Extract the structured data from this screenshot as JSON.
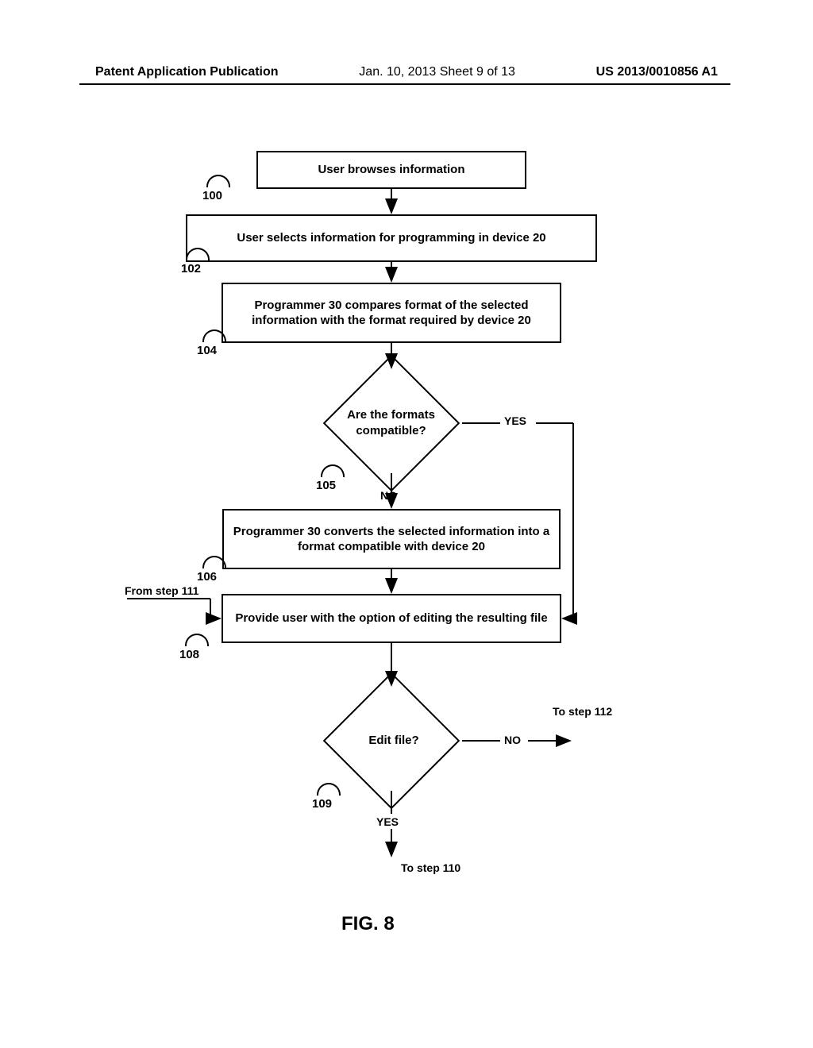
{
  "header": {
    "left": "Patent Application Publication",
    "center": "Jan. 10, 2013  Sheet 9 of 13",
    "right": "US 2013/0010856 A1"
  },
  "boxes": {
    "b100": "User browses information",
    "b102": "User selects information for programming in device 20",
    "b104": "Programmer 30 compares format of the selected information with the format required by device 20",
    "b106": "Programmer 30 converts the selected information into a format compatible with device 20",
    "b108": "Provide user with the option of editing the resulting file"
  },
  "diamonds": {
    "d105": "Are the formats compatible?",
    "d109": "Edit file?"
  },
  "refs": {
    "r100": "100",
    "r102": "102",
    "r104": "104",
    "r105": "105",
    "r106": "106",
    "r108": "108",
    "r109": "109"
  },
  "edges": {
    "yes1": "YES",
    "no1": "NO",
    "yes2": "YES",
    "no2": "NO",
    "from111": "From step 111",
    "to112": "To step 112",
    "to110": "To step 110"
  },
  "figure": "FIG. 8"
}
